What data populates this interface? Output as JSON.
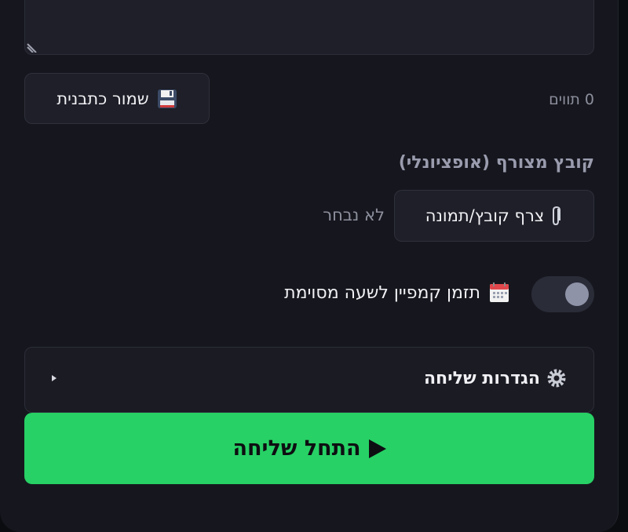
{
  "message": {
    "char_count": "0 תווים",
    "save_template_label": "שמור כתבנית"
  },
  "attachment": {
    "section_label": "קובץ מצורף (אופציונלי)",
    "button_label": "צרף קובץ/תמונה",
    "status": "לא נבחר"
  },
  "schedule": {
    "label": "תזמן קמפיין לשעה מסוימת",
    "enabled": false
  },
  "settings": {
    "title": "הגדרות שליחה"
  },
  "start": {
    "label": "התחל שליחה"
  },
  "colors": {
    "accent_green": "#27d165",
    "panel": "#16171e",
    "surface": "#1e1f28"
  },
  "icons": [
    "floppy-disk-icon",
    "paperclip-icon",
    "calendar-icon",
    "gear-icon",
    "play-icon",
    "chevron-right-icon",
    "resize-grip-icon"
  ]
}
